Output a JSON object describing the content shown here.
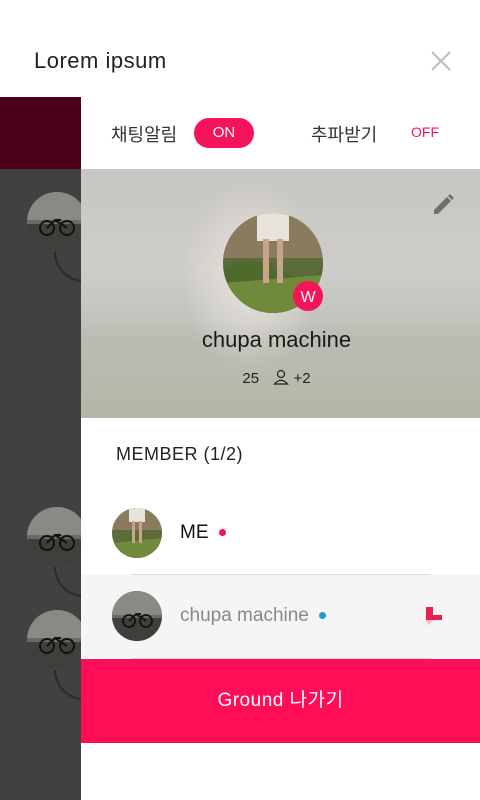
{
  "header": {
    "title": "Lorem ipsum",
    "close_icon": "close-icon"
  },
  "settings": {
    "chat_alert_label": "채팅알림",
    "chat_alert_state": "ON",
    "wave_label": "추파받기",
    "wave_state": "OFF"
  },
  "profile": {
    "name": "chupa machine",
    "badge": "W",
    "count": "25",
    "extra": "+2",
    "edit_icon": "pencil-icon"
  },
  "members": {
    "title": "MEMBER (1/2)",
    "items": [
      {
        "name": "ME",
        "dot_color": "#f5135a"
      },
      {
        "name": "chupa machine",
        "dot_color": "#1e9bd7",
        "action_icon": "heart-icon"
      }
    ]
  },
  "leave_button": {
    "label": "Ground 나가기"
  },
  "colors": {
    "accent": "#f5135a",
    "leave": "#ff0d56",
    "online_blue": "#1e9bd7"
  }
}
